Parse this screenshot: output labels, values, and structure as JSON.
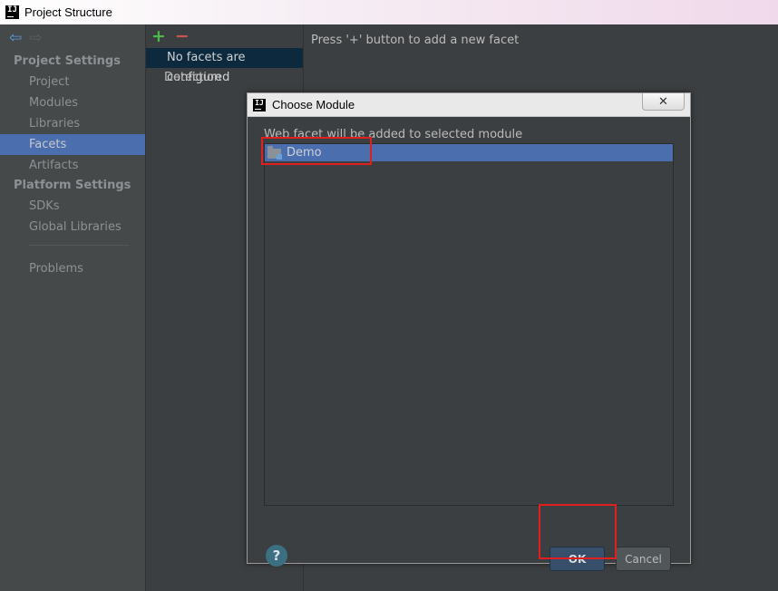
{
  "window": {
    "title": "Project Structure"
  },
  "nav": {
    "sections": [
      {
        "title": "Project Settings",
        "items": [
          "Project",
          "Modules",
          "Libraries",
          "Facets",
          "Artifacts"
        ]
      },
      {
        "title": "Platform Settings",
        "items": [
          "SDKs",
          "Global Libraries"
        ]
      }
    ],
    "selected": "Facets",
    "problems": "Problems"
  },
  "facets": {
    "add_icon": "+",
    "remove_icon": "−",
    "rows": [
      "No facets are configured",
      "Detection"
    ]
  },
  "content": {
    "hint": "Press '+' button to add a new facet"
  },
  "dialog": {
    "title": "Choose Module",
    "close_glyph": "✕",
    "instruction": "Web facet will be added to selected module",
    "modules": [
      "Demo"
    ],
    "help_glyph": "?",
    "ok_label": "OK",
    "cancel_label": "Cancel"
  },
  "colors": {
    "selection": "#4b6eaf",
    "dark_selection": "#0d293e",
    "highlight": "#e02020"
  }
}
